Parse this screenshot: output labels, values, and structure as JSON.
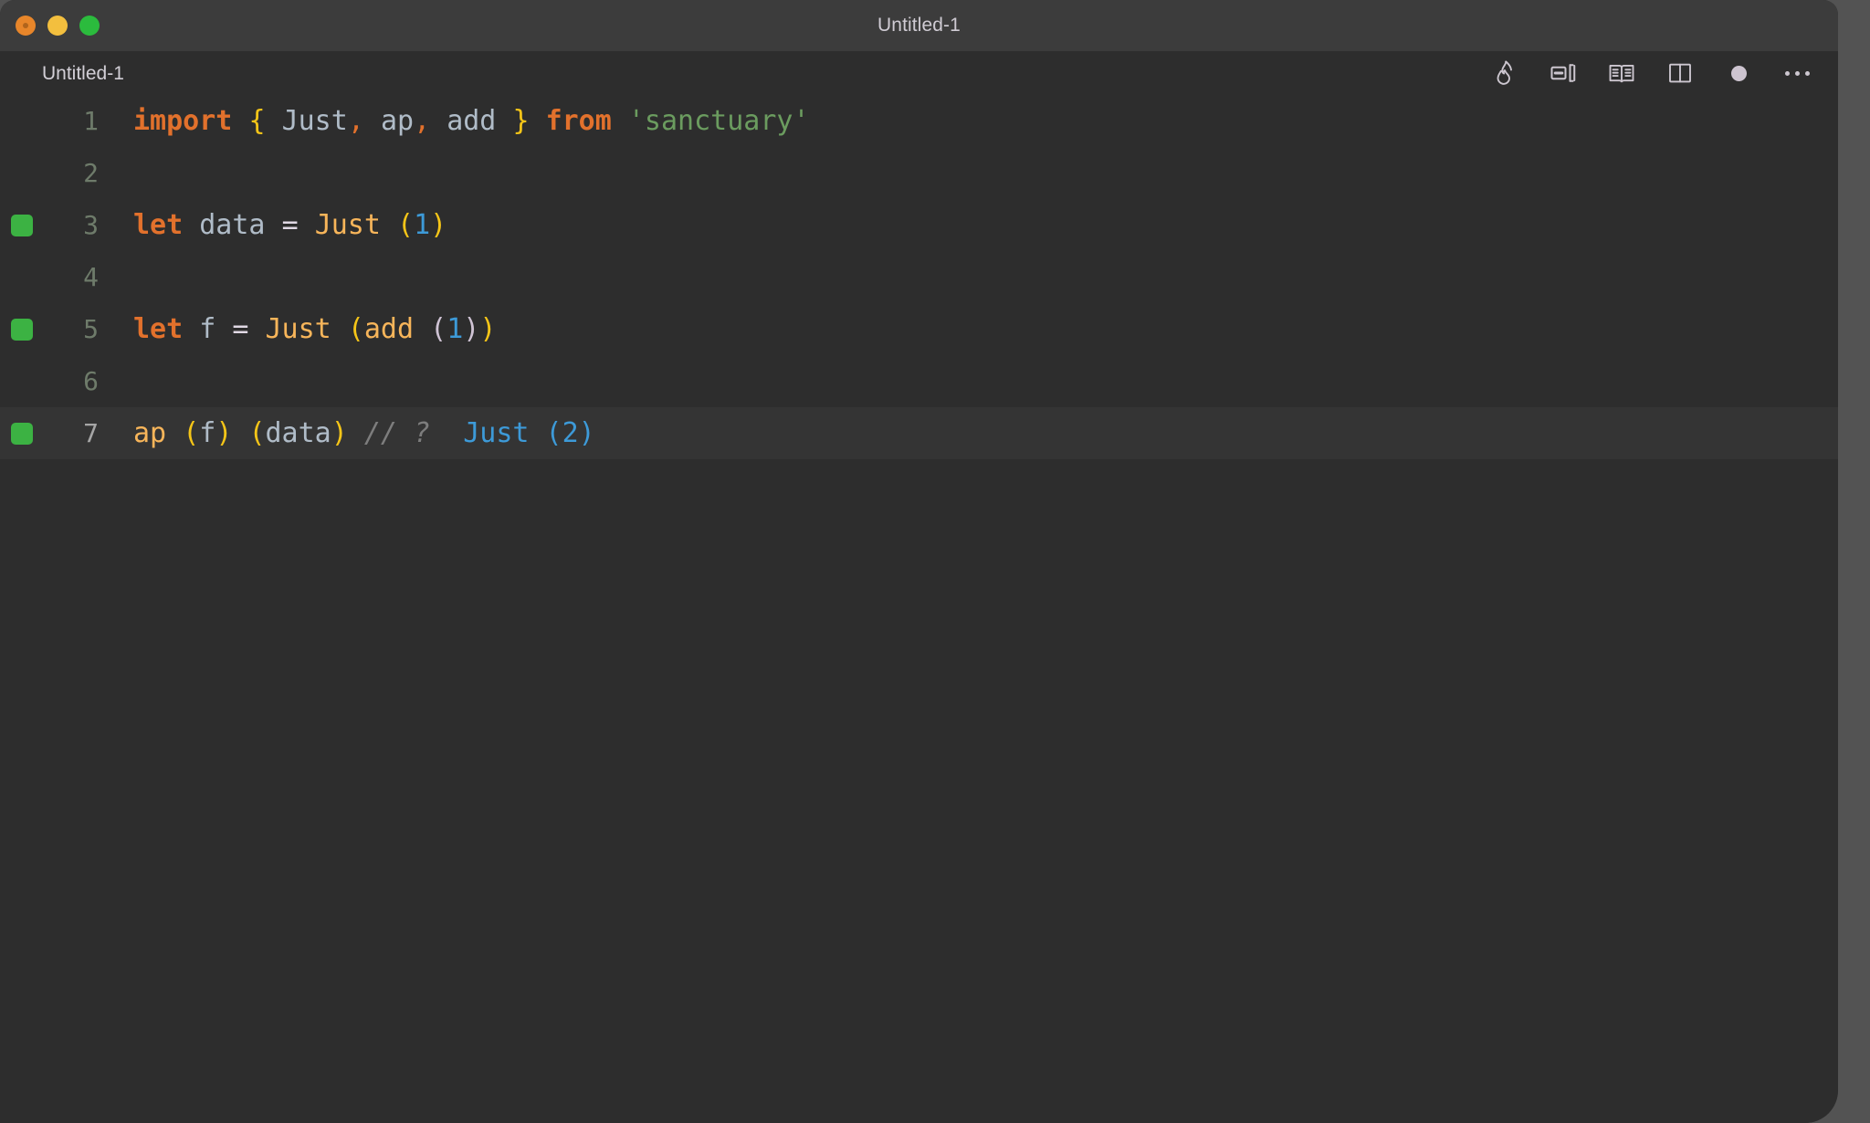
{
  "window": {
    "title": "Untitled-1",
    "traffic_lights": [
      {
        "name": "close",
        "color": "#e8862a"
      },
      {
        "name": "minimize",
        "color": "#f3bf3e"
      },
      {
        "name": "maximize",
        "color": "#2bbb3d"
      }
    ]
  },
  "tab": {
    "label": "Untitled-1"
  },
  "toolbar": {
    "items": [
      {
        "icon": "flame-icon",
        "label": "Quokka"
      },
      {
        "icon": "split-layout-icon",
        "label": "Toggle Panel"
      },
      {
        "icon": "open-book-icon",
        "label": "Open Preview"
      },
      {
        "icon": "split-editor-icon",
        "label": "Split Editor"
      },
      {
        "icon": "unsaved-dot-icon",
        "label": "Unsaved"
      },
      {
        "icon": "more-actions-icon",
        "label": "More Actions..."
      }
    ]
  },
  "editor": {
    "language": "javascript",
    "active_line": 7,
    "lines": [
      {
        "number": "1",
        "marker": false,
        "active": false,
        "tokens": [
          {
            "class": "t-kw",
            "text": "import"
          },
          {
            "class": "t-plain",
            "text": " "
          },
          {
            "class": "t-brace",
            "text": "{"
          },
          {
            "class": "t-plain",
            "text": " "
          },
          {
            "class": "t-ident",
            "text": "Just"
          },
          {
            "class": "t-punct",
            "text": ","
          },
          {
            "class": "t-plain",
            "text": " "
          },
          {
            "class": "t-ident",
            "text": "ap"
          },
          {
            "class": "t-punct",
            "text": ","
          },
          {
            "class": "t-plain",
            "text": " "
          },
          {
            "class": "t-ident",
            "text": "add"
          },
          {
            "class": "t-plain",
            "text": " "
          },
          {
            "class": "t-brace",
            "text": "}"
          },
          {
            "class": "t-plain",
            "text": " "
          },
          {
            "class": "t-kw",
            "text": "from"
          },
          {
            "class": "t-plain",
            "text": " "
          },
          {
            "class": "t-string",
            "text": "'sanctuary'"
          }
        ]
      },
      {
        "number": "2",
        "marker": false,
        "active": false,
        "tokens": []
      },
      {
        "number": "3",
        "marker": true,
        "active": false,
        "tokens": [
          {
            "class": "t-kw",
            "text": "let"
          },
          {
            "class": "t-plain",
            "text": " "
          },
          {
            "class": "t-var",
            "text": "data"
          },
          {
            "class": "t-plain",
            "text": " "
          },
          {
            "class": "t-op",
            "text": "="
          },
          {
            "class": "t-plain",
            "text": " "
          },
          {
            "class": "t-ctor",
            "text": "Just"
          },
          {
            "class": "t-plain",
            "text": " "
          },
          {
            "class": "t-paren1",
            "text": "("
          },
          {
            "class": "t-num",
            "text": "1"
          },
          {
            "class": "t-paren1",
            "text": ")"
          }
        ]
      },
      {
        "number": "4",
        "marker": false,
        "active": false,
        "tokens": []
      },
      {
        "number": "5",
        "marker": true,
        "active": false,
        "tokens": [
          {
            "class": "t-kw",
            "text": "let"
          },
          {
            "class": "t-plain",
            "text": " "
          },
          {
            "class": "t-var",
            "text": "f"
          },
          {
            "class": "t-plain",
            "text": " "
          },
          {
            "class": "t-op",
            "text": "="
          },
          {
            "class": "t-plain",
            "text": " "
          },
          {
            "class": "t-ctor",
            "text": "Just"
          },
          {
            "class": "t-plain",
            "text": " "
          },
          {
            "class": "t-paren1",
            "text": "("
          },
          {
            "class": "t-ctor",
            "text": "add"
          },
          {
            "class": "t-plain",
            "text": " "
          },
          {
            "class": "t-paren2",
            "text": "("
          },
          {
            "class": "t-num",
            "text": "1"
          },
          {
            "class": "t-paren2",
            "text": ")"
          },
          {
            "class": "t-paren1",
            "text": ")"
          }
        ]
      },
      {
        "number": "6",
        "marker": false,
        "active": false,
        "tokens": []
      },
      {
        "number": "7",
        "marker": true,
        "active": true,
        "tokens": [
          {
            "class": "t-fn",
            "text": "ap"
          },
          {
            "class": "t-plain",
            "text": " "
          },
          {
            "class": "t-paren1",
            "text": "("
          },
          {
            "class": "t-var",
            "text": "f"
          },
          {
            "class": "t-paren1",
            "text": ")"
          },
          {
            "class": "t-plain",
            "text": " "
          },
          {
            "class": "t-paren1",
            "text": "("
          },
          {
            "class": "t-var",
            "text": "data"
          },
          {
            "class": "t-paren1",
            "text": ")"
          },
          {
            "class": "t-plain",
            "text": " "
          },
          {
            "class": "t-comment",
            "text": "// ?"
          },
          {
            "class": "t-plain",
            "text": "  "
          },
          {
            "class": "t-result",
            "text": "Just (2)"
          }
        ]
      }
    ]
  }
}
